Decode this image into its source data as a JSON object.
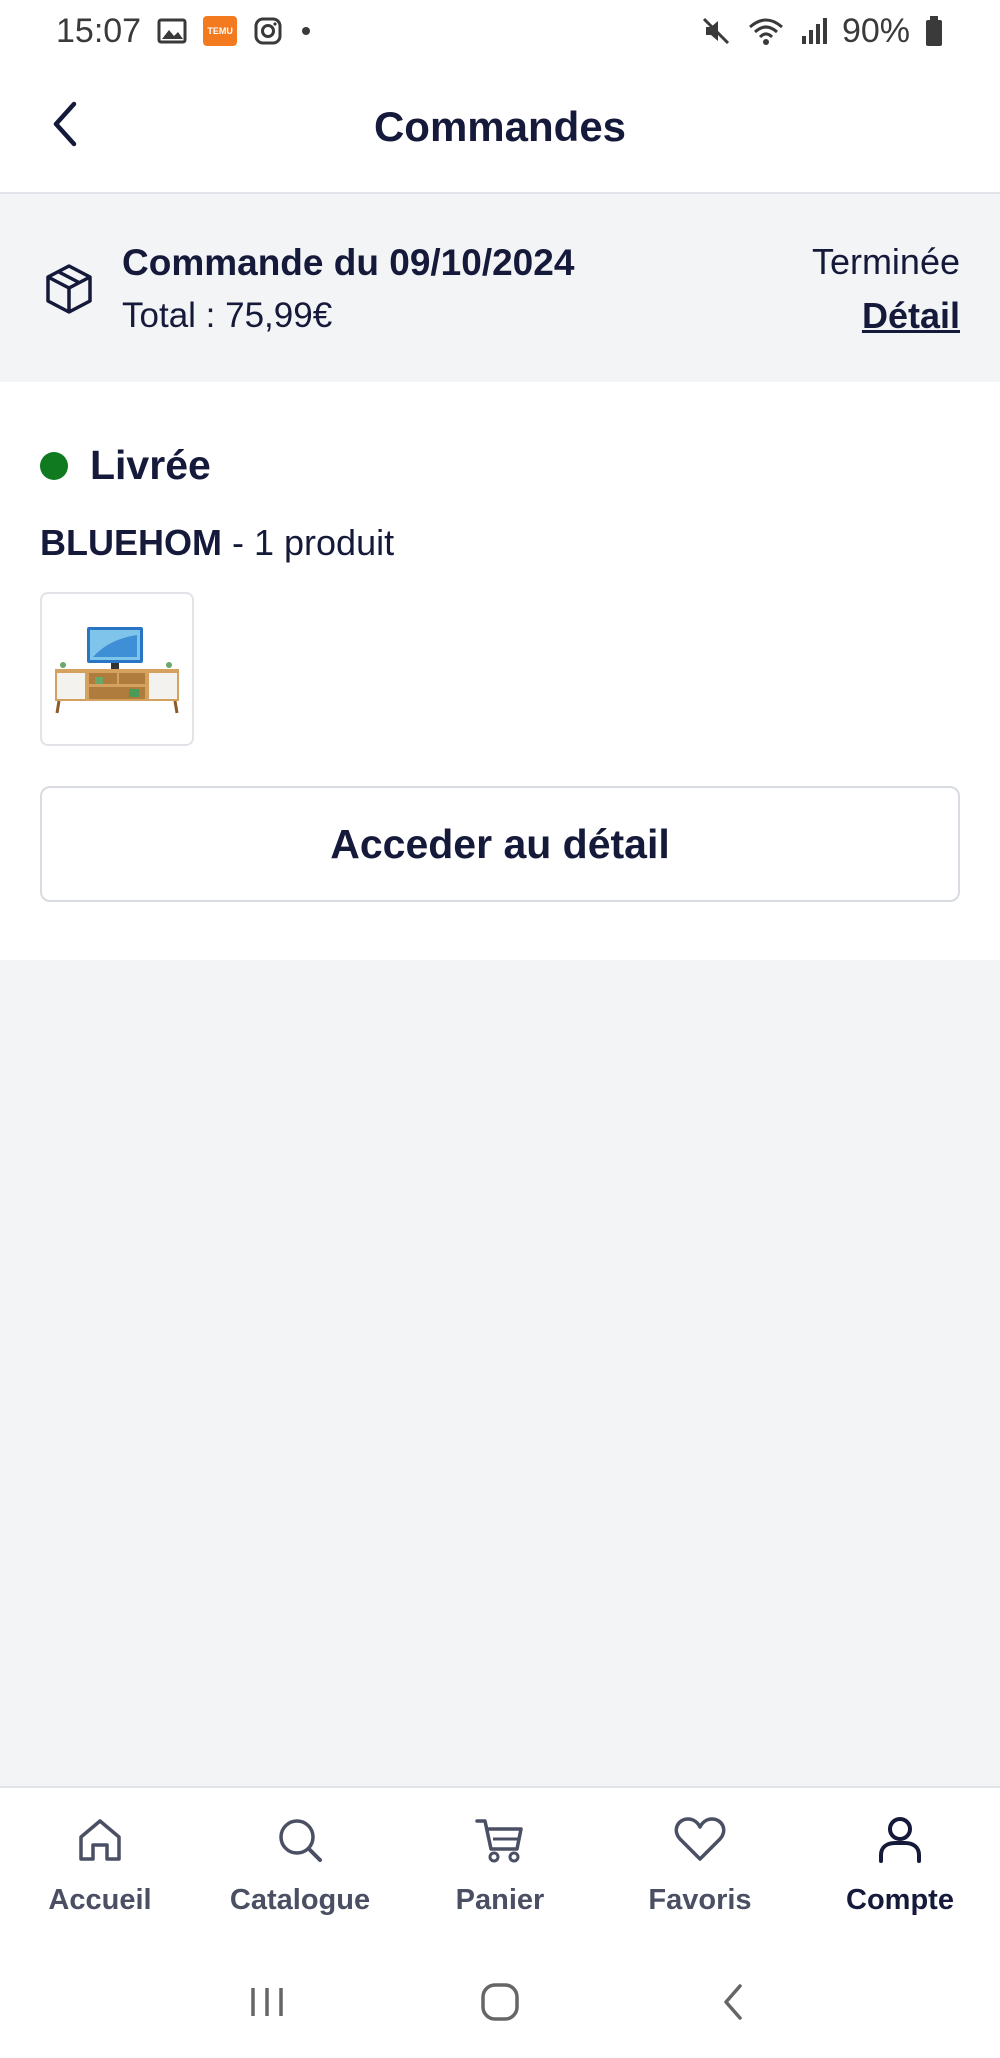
{
  "status_bar": {
    "time": "15:07",
    "battery": "90%",
    "icons": [
      "image-icon",
      "temu-app-icon",
      "instagram-icon",
      "dot-icon",
      "mute-icon",
      "wifi-icon",
      "signal-icon",
      "battery-icon"
    ]
  },
  "header": {
    "title": "Commandes"
  },
  "order": {
    "date_label": "Commande du 09/10/2024",
    "total_label": "Total : 75,99€",
    "status": "Terminée",
    "detail_link": "Détail"
  },
  "delivery": {
    "status": "Livrée",
    "status_color": "#0f7a1f",
    "seller": "BLUEHOM",
    "product_count": " - 1 produit",
    "button_label": "Acceder au détail"
  },
  "bottom_nav": {
    "items": [
      {
        "label": "Accueil",
        "icon": "home-icon"
      },
      {
        "label": "Catalogue",
        "icon": "search-icon"
      },
      {
        "label": "Panier",
        "icon": "cart-icon"
      },
      {
        "label": "Favoris",
        "icon": "heart-icon"
      },
      {
        "label": "Compte",
        "icon": "user-icon",
        "active": true
      }
    ]
  },
  "colors": {
    "primary_text": "#15193a",
    "background": "#f3f4f6",
    "delivered": "#0f7a1f"
  }
}
